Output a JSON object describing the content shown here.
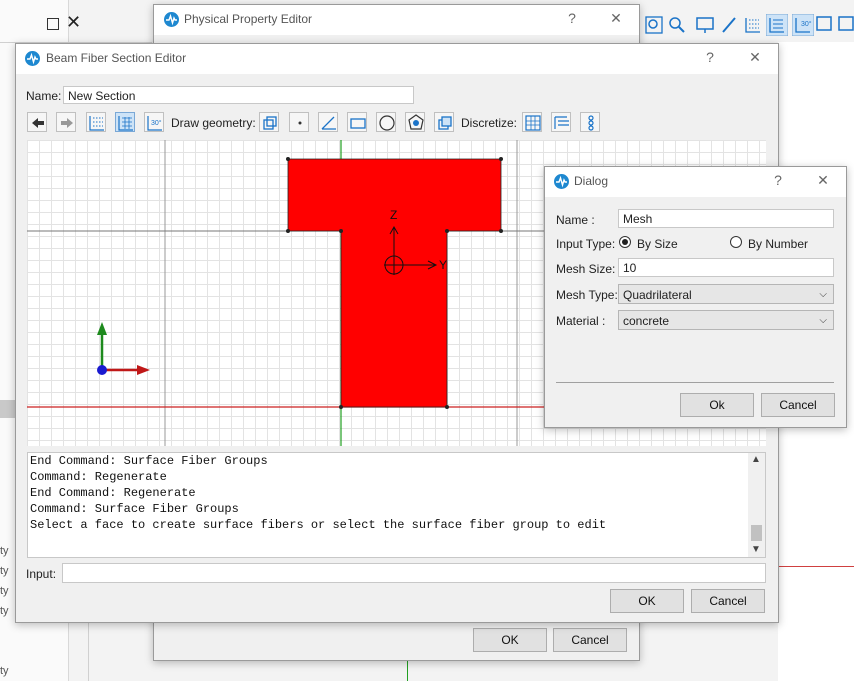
{
  "background": {
    "side_labels": [
      "ty",
      "ty",
      "ty",
      "ty",
      "ty"
    ]
  },
  "physical_property_editor": {
    "title": "Physical Property Editor",
    "help": "?",
    "close": "✕",
    "ok_label": "OK",
    "cancel_label": "Cancel"
  },
  "beam_fiber_editor": {
    "title": "Beam Fiber Section Editor",
    "help": "?",
    "close": "✕",
    "name_label": "Name:",
    "name_value": "New Section",
    "draw_geometry_label": "Draw geometry:",
    "discretize_label": "Discretize:",
    "axis_z": "Z",
    "axis_y": "Y",
    "console_lines": [
      "End Command: Surface Fiber Groups",
      "Command: Regenerate",
      "End Command: Regenerate",
      "Command: Surface Fiber Groups",
      "Select a face to create surface fibers or select the surface fiber group to edit"
    ],
    "input_label": "Input:",
    "input_value": "",
    "ok_label": "OK",
    "cancel_label": "Cancel"
  },
  "dialog": {
    "title": "Dialog",
    "help": "?",
    "close": "✕",
    "name_label": "Name :",
    "name_value": "Mesh",
    "input_type_label": "Input Type:",
    "option_by_size": "By Size",
    "option_by_number": "By Number",
    "selected_option": "By Size",
    "mesh_size_label": "Mesh Size:",
    "mesh_size_value": "10",
    "mesh_type_label": "Mesh Type:",
    "mesh_type_value": "Quadrilateral",
    "material_label": "Material :",
    "material_value": "concrete",
    "ok_label": "Ok",
    "cancel_label": "Cancel"
  },
  "colors": {
    "section_fill": "#ff0000",
    "x_axis": "#cc2020",
    "y_axis": "#22a022",
    "accent": "#1e88d0"
  }
}
